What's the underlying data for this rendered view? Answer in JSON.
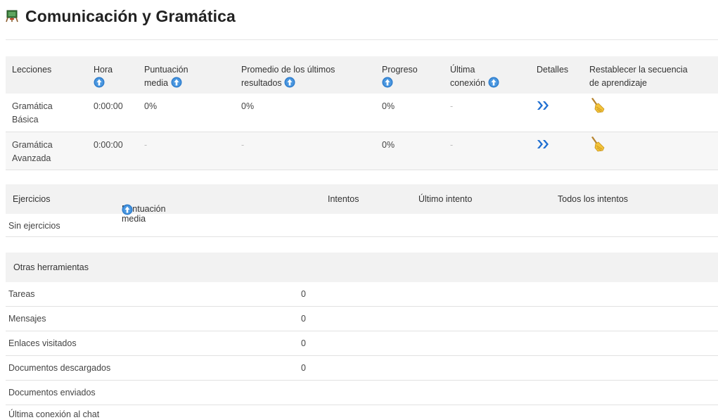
{
  "course": {
    "title": "Comunicación y Gramática",
    "icon": "course-book-icon"
  },
  "lessons": {
    "headers": {
      "lessons": "Lecciones",
      "time": "Hora",
      "avg_score_1": "Puntuación",
      "avg_score_2": "media",
      "last_results_1": "Promedio de los últimos",
      "last_results_2": "resultados",
      "progress": "Progreso",
      "last_connection_1": "Última",
      "last_connection_2": "conexión",
      "details": "Detalles",
      "reset_1": "Restablecer la secuencia",
      "reset_2": "de aprendizaje"
    },
    "rows": [
      {
        "name_1": "Gramática",
        "name_2": "Básica",
        "time": "0:00:00",
        "avg_score": "0%",
        "last_results": "0%",
        "progress": "0%",
        "last_connection": "-"
      },
      {
        "name_1": "Gramática",
        "name_2": "Avanzada",
        "time": "0:00:00",
        "avg_score": "-",
        "last_results": "-",
        "progress": "0%",
        "last_connection": "-"
      }
    ]
  },
  "exercises": {
    "headers": {
      "exercises": "Ejercicios",
      "avg_score": "Puntuación media",
      "attempts": "Intentos",
      "last_attempt": "Último intento",
      "all_attempts": "Todos los intentos"
    },
    "empty": "Sin ejercicios"
  },
  "tools": {
    "title": "Otras herramientas",
    "rows": [
      {
        "label": "Tareas",
        "value": "0"
      },
      {
        "label": "Mensajes",
        "value": "0"
      },
      {
        "label": "Enlaces visitados",
        "value": "0"
      },
      {
        "label": "Documentos descargados",
        "value": "0"
      },
      {
        "label": "Documentos enviados",
        "value": ""
      },
      {
        "label": "Última conexión al chat",
        "value": ""
      }
    ]
  },
  "colors": {
    "info_blue": "#2f7dcc",
    "header_bg": "#f2f2f2",
    "arrow_blue": "#1f6fd1"
  }
}
